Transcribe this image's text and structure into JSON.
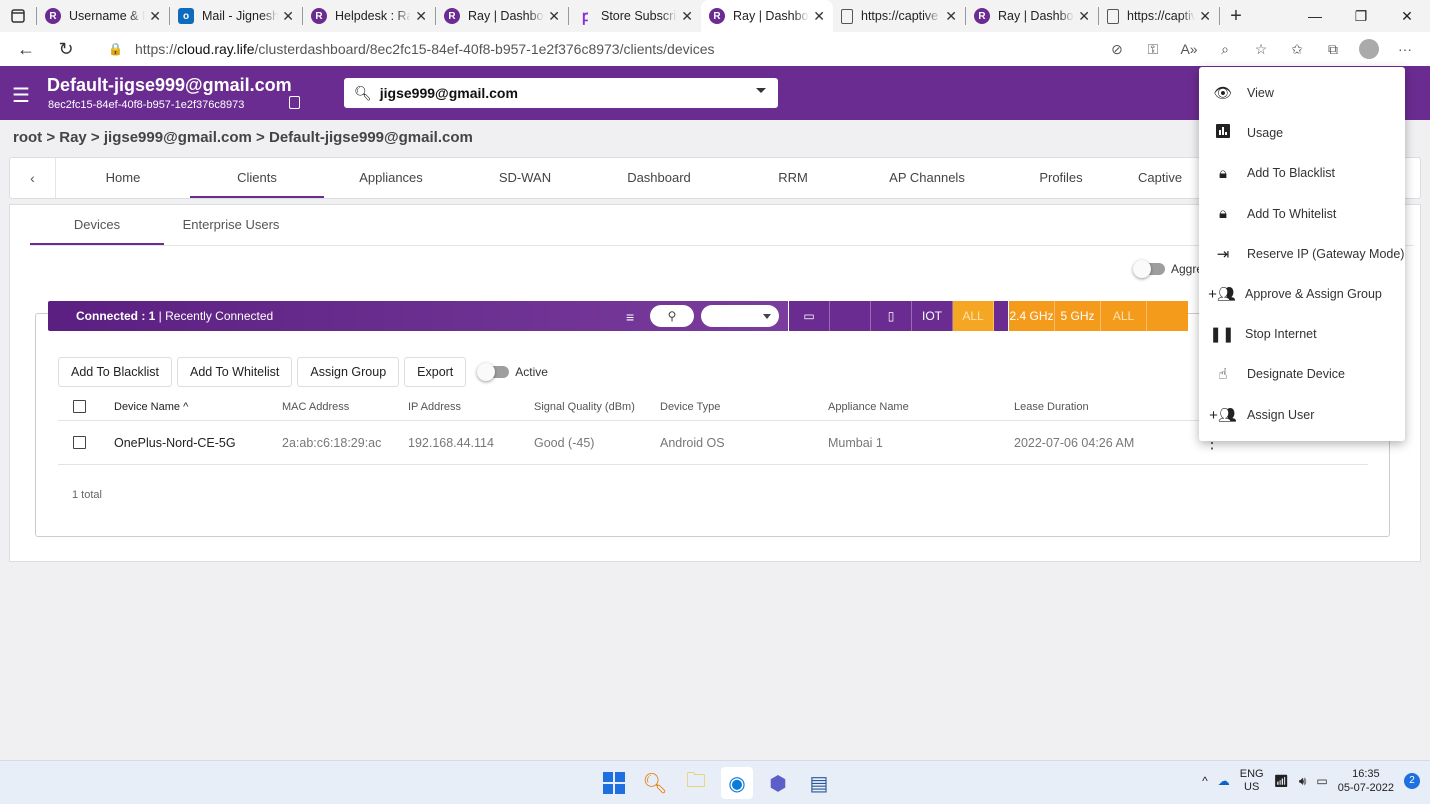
{
  "browser": {
    "tabs": [
      {
        "title": "Username & P",
        "icon": "ray-icon",
        "active": false
      },
      {
        "title": "Mail - Jignesh",
        "icon": "outlook-icon",
        "active": false
      },
      {
        "title": "Helpdesk : Ray",
        "icon": "ray-icon",
        "active": false
      },
      {
        "title": "Ray | Dashboa",
        "icon": "ray-icon",
        "active": false
      },
      {
        "title": "Store Subscrip",
        "icon": "store-icon",
        "active": false
      },
      {
        "title": "Ray | Dashboa",
        "icon": "ray-icon",
        "active": true
      },
      {
        "title": "https://captive",
        "icon": "document-icon",
        "active": false
      },
      {
        "title": "Ray | Dashboa",
        "icon": "ray-icon",
        "active": false
      },
      {
        "title": "https://captive",
        "icon": "document-icon",
        "active": false
      }
    ],
    "url_prefix": "https://",
    "url_host": "cloud.ray.life",
    "url_path": "/clusterdashboard/8ec2fc15-84ef-40f8-b957-1e2f376c8973/clients/devices"
  },
  "header": {
    "tenant_name": "Default-jigse999@gmail.com",
    "tenant_id": "8ec2fc15-84ef-40f8-b957-1e2f376c8973",
    "search_value": "jigse999@gmail.com"
  },
  "breadcrumb": "root > Ray > jigse999@gmail.com > Default-jigse999@gmail.com",
  "nav": {
    "tabs": [
      "Home",
      "Clients",
      "Appliances",
      "SD-WAN",
      "Dashboard",
      "RRM",
      "AP Channels",
      "Profiles",
      "Captive"
    ],
    "active": "Clients"
  },
  "subtabs": [
    "Devices",
    "Enterprise Users"
  ],
  "aggregate_label": "Aggre",
  "filterbar": {
    "connected_label": "Connected : 1",
    "recently_label": " | Recently Connected",
    "device_types": [
      "laptop-icon",
      "apple-icon",
      "phone-icon"
    ],
    "iot": "IOT",
    "all1": "ALL",
    "bands": [
      "2.4 GHz",
      "5 GHz",
      "ALL"
    ]
  },
  "actions": {
    "blacklist": "Add To Blacklist",
    "whitelist": "Add To Whitelist",
    "assign_group": "Assign Group",
    "export": "Export",
    "active": "Active"
  },
  "table": {
    "headers": {
      "name": "Device Name ^",
      "mac": "MAC Address",
      "ip": "IP Address",
      "signal": "Signal Quality (dBm)",
      "type": "Device Type",
      "appliance": "Appliance Name",
      "lease": "Lease Duration"
    },
    "rows": [
      {
        "name": "OnePlus-Nord-CE-5G",
        "mac": "2a:ab:c6:18:29:ac",
        "ip": "192.168.44.114",
        "signal": "Good (-45)",
        "type": "Android OS",
        "appliance": "Mumbai 1",
        "lease": "2022-07-06 04:26 AM"
      }
    ],
    "total": "1 total"
  },
  "menu": [
    {
      "label": "View",
      "icon": "eye-icon"
    },
    {
      "label": "Usage",
      "icon": "bar-chart-icon"
    },
    {
      "label": "Add To Blacklist",
      "icon": "lock-icon"
    },
    {
      "label": "Add To Whitelist",
      "icon": "lock-icon"
    },
    {
      "label": "Reserve IP (Gateway Mode)",
      "icon": "login-icon"
    },
    {
      "label": "Approve & Assign Group",
      "icon": "group-add-icon"
    },
    {
      "label": "Stop Internet",
      "icon": "pause-icon"
    },
    {
      "label": "Designate Device",
      "icon": "touch-icon"
    },
    {
      "label": "Assign User",
      "icon": "group-add-icon"
    }
  ],
  "taskbar": {
    "lang_top": "ENG",
    "lang_bottom": "US",
    "time": "16:35",
    "date": "05-07-2022",
    "notifications": "2"
  }
}
